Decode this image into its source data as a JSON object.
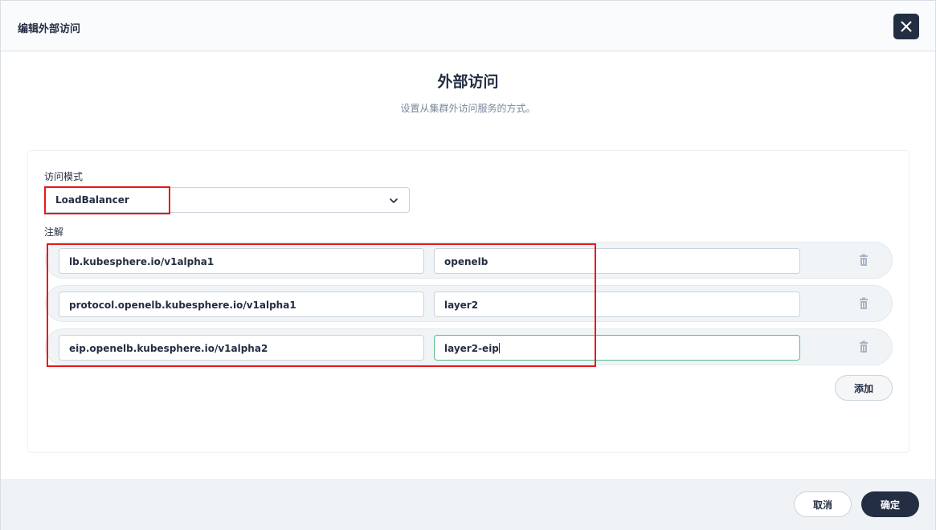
{
  "dialog": {
    "title": "编辑外部访问",
    "heading": "外部访问",
    "description": "设置从集群外访问服务的方式。"
  },
  "access_mode": {
    "label": "访问模式",
    "value": "LoadBalancer"
  },
  "annotations": {
    "label": "注解",
    "rows": [
      {
        "key": "lb.kubesphere.io/v1alpha1",
        "value": "openelb"
      },
      {
        "key": "protocol.openelb.kubesphere.io/v1alpha1",
        "value": "layer2"
      },
      {
        "key": "eip.openelb.kubesphere.io/v1alpha2",
        "value": "layer2-eip"
      }
    ],
    "add_label": "添加"
  },
  "footer": {
    "cancel_label": "取消",
    "confirm_label": "确定"
  },
  "icons": {
    "close": "close-icon",
    "chevron": "chevron-down-icon",
    "delete": "trash-icon"
  },
  "colors": {
    "primary_dark": "#242e42",
    "focus_green": "#55bc8a",
    "highlight_red": "#e8181b"
  }
}
